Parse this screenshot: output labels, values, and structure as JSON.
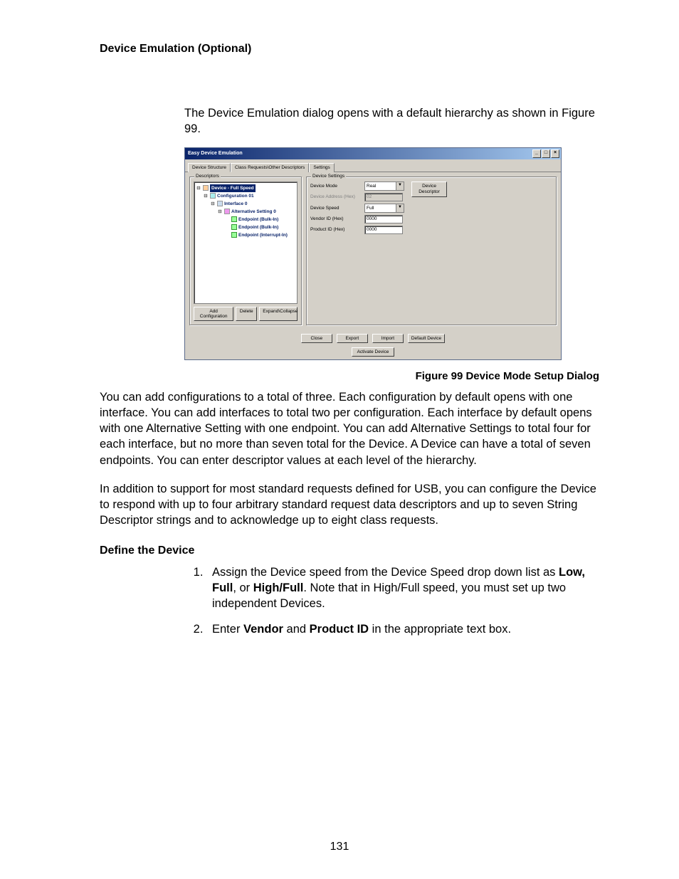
{
  "heading": "Device Emulation (Optional)",
  "intro": "The Device Emulation dialog opens with a default hierarchy as shown in Figure 99.",
  "dialog": {
    "title": "Easy Device Emulation",
    "window_controls": {
      "min": "_",
      "max": "□",
      "close": "×"
    },
    "tabs": [
      "Device Structure",
      "Class Requests\\Other Descriptors",
      "Settings"
    ],
    "descriptors_group_label": "Descriptors",
    "tree": {
      "n0": "Device - Full Speed",
      "n1": "Configuration 01",
      "n2": "Interface 0",
      "n3": "Alternative Setting 0",
      "n4": "Endpoint (Bulk-In)",
      "n5": "Endpoint (Bulk-In)",
      "n6": "Endpoint (Interrupt-In)"
    },
    "tree_buttons": {
      "add": "Add Configuration",
      "delete": "Delete",
      "expand": "Expand\\Collapse"
    },
    "settings_group_label": "Device Settings",
    "settings": {
      "mode_label": "Device Mode",
      "mode_value": "Real",
      "addr_label": "Device Address (Hex)",
      "addr_value": "02",
      "speed_label": "Device Speed",
      "speed_value": "Full",
      "vendor_label": "Vendor ID (Hex)",
      "vendor_value": "0000",
      "product_label": "Product ID (Hex)",
      "product_value": "0000",
      "device_descriptor_btn_l1": "Device",
      "device_descriptor_btn_l2": "Descriptor"
    },
    "bottom_buttons": {
      "close": "Close",
      "export": "Export",
      "import": "Import",
      "default": "Default Device",
      "activate": "Activate Device"
    }
  },
  "figure_caption": "Figure  99  Device Mode Setup Dialog",
  "para1": "You can add configurations to a total of three. Each configuration by default opens with one interface. You can add interfaces to total two per configuration. Each interface by default opens with one Alternative Setting with one endpoint. You can add Alternative Settings to total four for each interface, but no more than seven total for the Device. A Device can have a total of seven endpoints. You can enter descriptor values at each level of the hierarchy.",
  "para2": "In addition to support for most standard requests defined for USB, you can configure the Device to respond with up to four arbitrary standard request data descriptors and up to seven String Descriptor strings and to acknowledge up to eight class requests.",
  "subheading": "Define the Device",
  "steps": {
    "s1_pre": "Assign the Device speed from the Device Speed drop down list as ",
    "s1_b1": "Low, Full",
    "s1_mid": ", or ",
    "s1_b2": "High/Full",
    "s1_post": ". Note that in High/Full speed, you must set up two independent Devices.",
    "s2_pre": "Enter ",
    "s2_b1": "Vendor",
    "s2_mid": " and ",
    "s2_b2": "Product ID",
    "s2_post": " in the appropriate text box."
  },
  "page_number": "131"
}
